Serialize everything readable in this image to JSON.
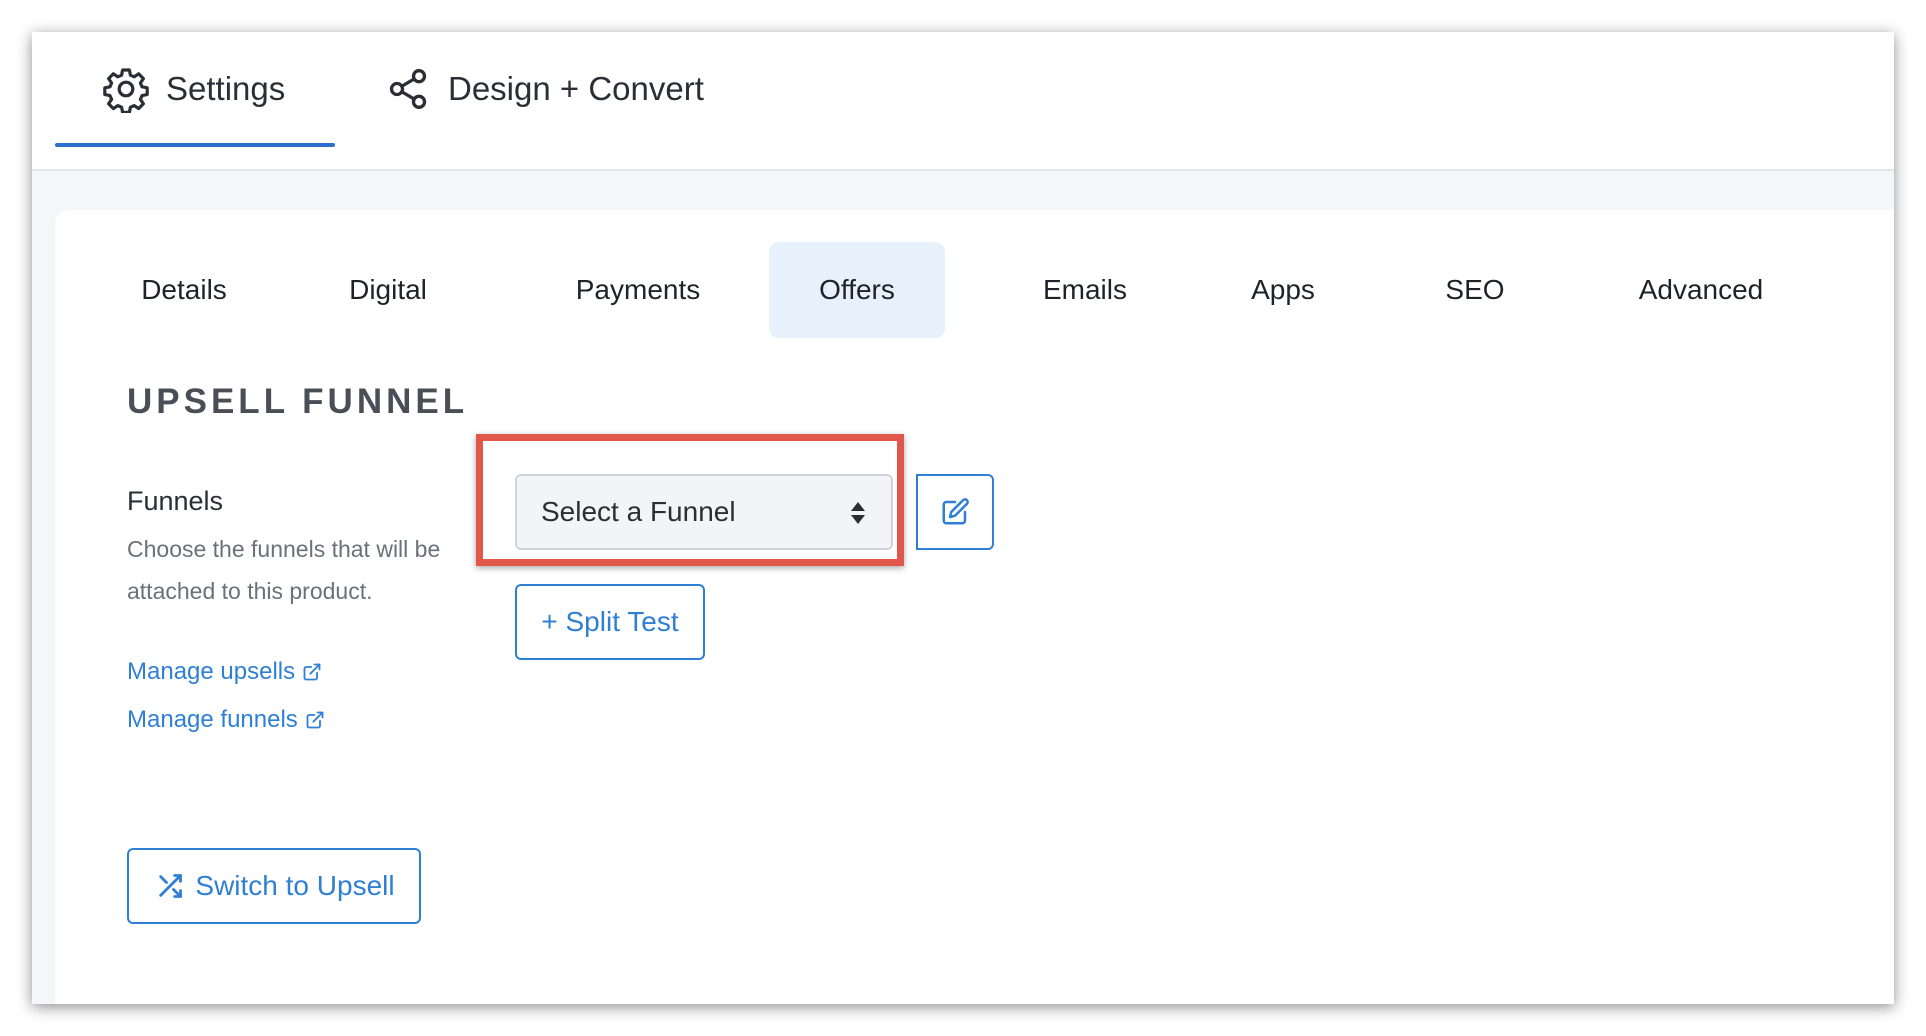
{
  "top_tabs": [
    {
      "label": "Settings",
      "icon": "gear-icon",
      "active": true
    },
    {
      "label": "Design + Convert",
      "icon": "share-icon",
      "active": false
    }
  ],
  "sub_tabs": [
    {
      "label": "Details",
      "active": false
    },
    {
      "label": "Digital",
      "active": false
    },
    {
      "label": "Payments",
      "active": false
    },
    {
      "label": "Offers",
      "active": true
    },
    {
      "label": "Emails",
      "active": false
    },
    {
      "label": "Apps",
      "active": false
    },
    {
      "label": "SEO",
      "active": false
    },
    {
      "label": "Advanced",
      "active": false
    }
  ],
  "section": {
    "title": "UPSELL FUNNEL",
    "field_label": "Funnels",
    "field_help": "Choose the funnels that will be attached to this product.",
    "links": [
      {
        "label": "Manage upsells",
        "icon": "external-link-icon"
      },
      {
        "label": "Manage funnels",
        "icon": "external-link-icon"
      }
    ],
    "select": {
      "value": "Select a Funnel",
      "icon": "sort-arrows-icon"
    },
    "edit_button_icon": "edit-icon",
    "split_test_label": "+ Split Test",
    "switch_label": "Switch to Upsell",
    "switch_icon": "shuffle-icon"
  },
  "colors": {
    "accent": "#2f7fd4",
    "underline": "#2c6fcc",
    "active_tab_bg": "#e6f1fc",
    "highlight": "#e1584b"
  }
}
